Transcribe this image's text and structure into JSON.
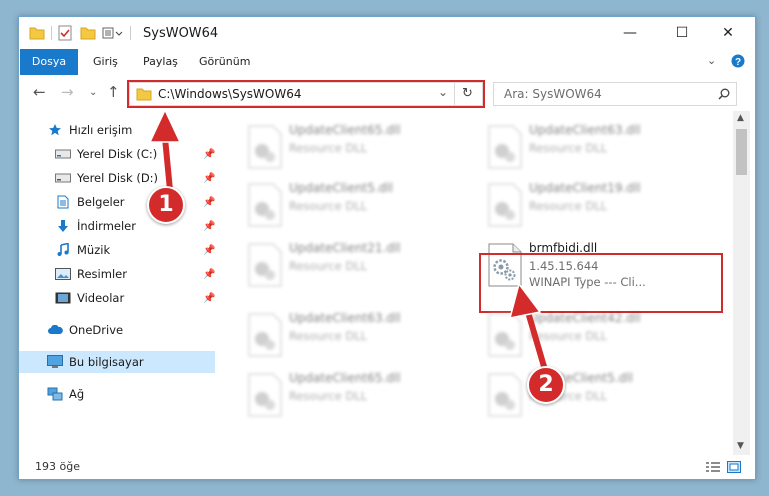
{
  "window": {
    "title": "SysWOW64"
  },
  "ribbon": {
    "tabs": [
      "Dosya",
      "Giriş",
      "Paylaş",
      "Görünüm"
    ]
  },
  "navbar": {
    "address": "C:\\Windows\\SysWOW64",
    "search_placeholder": "Ara: SysWOW64"
  },
  "sidebar": {
    "quick_access": "Hızlı erişim",
    "pinned": [
      "Yerel Disk (C:)",
      "Yerel Disk (D:)",
      "Belgeler",
      "İndirmeler",
      "Müzik",
      "Resimler",
      "Videolar"
    ],
    "onedrive": "OneDrive",
    "this_pc": "Bu bilgisayar",
    "network": "Ağ"
  },
  "files": [
    {
      "name": "UpdateClient65.dll",
      "desc": "Resource DLL"
    },
    {
      "name": "UpdateClient63.dll",
      "desc": "Resource DLL"
    },
    {
      "name": "UpdateClient5.dll",
      "desc": "Resource DLL"
    },
    {
      "name": "UpdateClient19.dll",
      "desc": "Resource DLL"
    },
    {
      "name": "UpdateClient21.dll",
      "desc": "Resource DLL"
    },
    {
      "name": "brmfbidi.dll",
      "version": "1.45.15.644",
      "desc": "WINAPI Type --- Cli..."
    },
    {
      "name": "UpdateClient63.dll",
      "desc": "Resource DLL"
    },
    {
      "name": "UpdateClient42.dll",
      "desc": "Resource DLL"
    },
    {
      "name": "UpdateClient65.dll",
      "desc": "Resource DLL"
    },
    {
      "name": "UpdateClient5.dll",
      "desc": "Resource DLL"
    }
  ],
  "status": {
    "item_count": "193 öğe"
  },
  "callouts": [
    "1",
    "2"
  ],
  "colors": {
    "accent": "#1979ca",
    "highlight": "#d32b2b",
    "selected": "#cce8ff"
  }
}
